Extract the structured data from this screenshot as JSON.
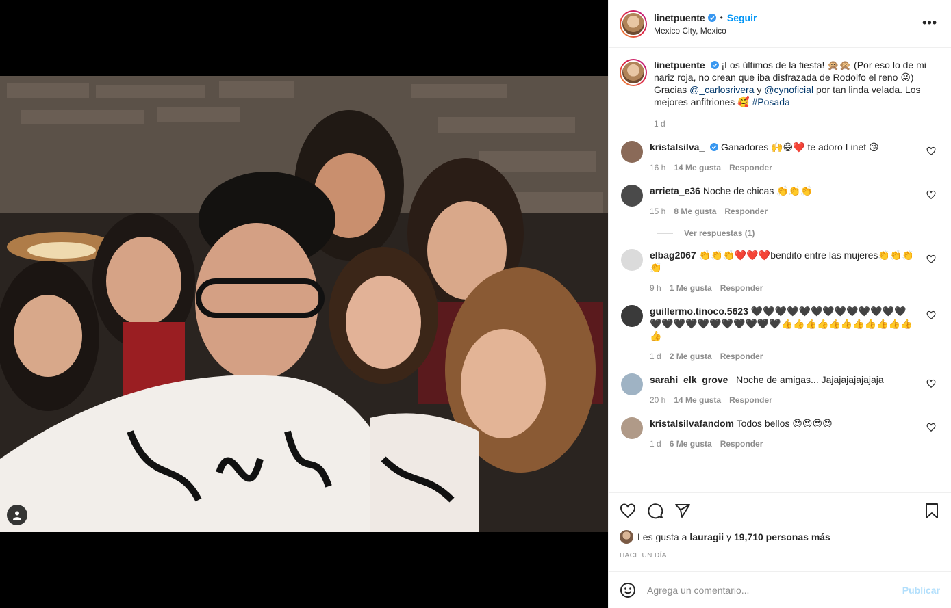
{
  "post": {
    "username": "linetpuente",
    "follow_label": "Seguir",
    "location": "Mexico City, Mexico",
    "caption_pre": "¡Los últimos de la fiesta! 🙊🙊 (Por eso lo de mi nariz roja, no crean que iba disfrazada de Rodolfo el reno 😛) Gracias ",
    "mention_1": "@_carlosrivera",
    "caption_mid": " y ",
    "mention_2": "@cynoficial",
    "caption_post": " por tan linda velada. Los mejores anfitriones 🥰 ",
    "hashtag": "#Posada",
    "caption_time": "1 d"
  },
  "comments": [
    {
      "user": "kristalsilva_",
      "text": "Ganadores 🙌😅❤️ te adoro Linet 😘",
      "time": "16 h",
      "likes": "14 Me gusta",
      "reply": "Responder",
      "color": "#8a6a58"
    },
    {
      "user": "arrieta_e36",
      "text": "Noche de chicas 👏👏👏",
      "time": "15 h",
      "likes": "8 Me gusta",
      "reply": "Responder",
      "color": "#4a4a4a"
    },
    {
      "user": "elbag2067",
      "text": "👏👏👏❤️❤️❤️bendito entre las mujeres👏👏👏👏",
      "time": "9 h",
      "likes": "1 Me gusta",
      "reply": "Responder",
      "color": "#dbdbdb"
    },
    {
      "user": "guillermo.tinoco.5623",
      "text": "🖤🖤🖤🖤🖤🖤🖤🖤🖤🖤🖤🖤🖤🖤🖤🖤🖤🖤🖤🖤🖤🖤🖤🖤👍👍👍👍👍👍👍👍👍👍👍👍",
      "time": "1 d",
      "likes": "2 Me gusta",
      "reply": "Responder",
      "color": "#3a3a3a"
    },
    {
      "user": "sarahi_elk_grove_",
      "text": "Noche de amigas... Jajajajajajajaja",
      "time": "20 h",
      "likes": "14 Me gusta",
      "reply": "Responder",
      "color": "#9fb3c4"
    },
    {
      "user": "kristalsilvafandom",
      "text": "Todos bellos 😍😍😍😍",
      "time": "1 d",
      "likes": "6 Me gusta",
      "reply": "Responder",
      "color": "#b09a88"
    }
  ],
  "view_replies": "Ver respuestas (1)",
  "likes_line": {
    "pre": "Les gusta a ",
    "user": "lauragii",
    "mid": " y ",
    "count": "19,710 personas más"
  },
  "post_age": "HACE UN DÍA",
  "comment_box": {
    "placeholder": "Agrega un comentario...",
    "publish": "Publicar"
  },
  "icons": [
    "verified-icon",
    "more-options-icon",
    "heart-icon",
    "comment-icon",
    "share-icon",
    "save-icon",
    "emoji-icon",
    "user-tag-icon"
  ],
  "colors": {
    "accent": "#0095f6",
    "link": "#00376b",
    "muted": "#8e8e8e"
  }
}
